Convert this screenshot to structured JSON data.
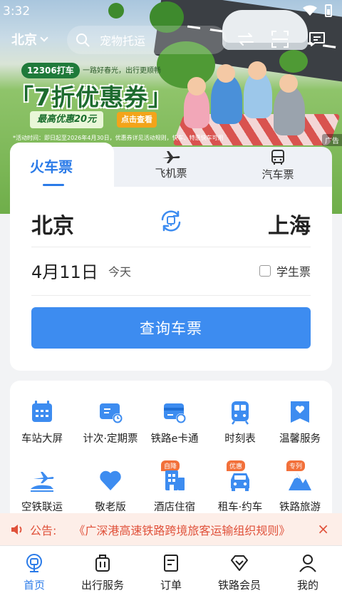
{
  "status_bar": {
    "time": "3:32"
  },
  "header": {
    "city": "北京",
    "search_placeholder": "宠物托运"
  },
  "banner": {
    "pill": "12306打车",
    "subtitle": "一路好春光，出行更顺畅",
    "title": "「7折优惠券」",
    "max_discount": "最高优惠20元",
    "cta": "点击查看",
    "note": "*活动时间：即日起至2026年4月30日，优惠券详见活动规则，快车、特惠快车可用",
    "ad_label": "广告"
  },
  "tabs": {
    "train": "火车票",
    "flight": "飞机票",
    "bus": "汽车票"
  },
  "booking": {
    "from": "北京",
    "to": "上海",
    "date": "4月11日",
    "day_label": "今天",
    "student_label": "学生票",
    "search_button": "查询车票"
  },
  "services": [
    {
      "label": "车站大屏",
      "icon": "station-screen-icon"
    },
    {
      "label": "计次·定期票",
      "icon": "ticket-card-icon"
    },
    {
      "label": "铁路e卡通",
      "icon": "e-card-icon"
    },
    {
      "label": "时刻表",
      "icon": "train-timetable-icon"
    },
    {
      "label": "温馨服务",
      "icon": "heart-service-icon"
    },
    {
      "label": "空铁联运",
      "icon": "air-rail-icon"
    },
    {
      "label": "敬老版",
      "icon": "heart-icon"
    },
    {
      "label": "酒店住宿",
      "icon": "hotel-icon",
      "tag": "自降"
    },
    {
      "label": "租车·约车",
      "icon": "car-icon",
      "tag": "优惠"
    },
    {
      "label": "铁路旅游",
      "icon": "mountain-icon",
      "tag": "专列"
    }
  ],
  "notice": {
    "label": "公告:",
    "text": "《广深港高速铁路跨境旅客运输组织规则》"
  },
  "bottom_nav": [
    {
      "label": "首页",
      "icon": "home-train-icon"
    },
    {
      "label": "出行服务",
      "icon": "luggage-icon"
    },
    {
      "label": "订单",
      "icon": "order-icon"
    },
    {
      "label": "铁路会员",
      "icon": "diamond-icon"
    },
    {
      "label": "我的",
      "icon": "user-icon"
    }
  ],
  "colors": {
    "primary": "#2b7be8",
    "button": "#3d8cf0",
    "notice": "#e0513a",
    "tag": "#f2703a"
  }
}
